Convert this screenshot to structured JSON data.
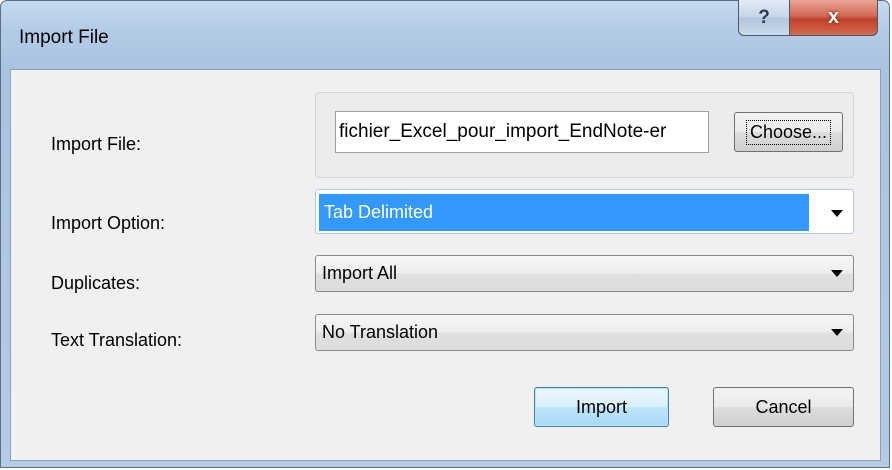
{
  "window": {
    "title": "Import File",
    "help_label": "?",
    "close_label": "x"
  },
  "form": {
    "import_file": {
      "label": "Import File:",
      "value": "fichier_Excel_pour_import_EndNote-er",
      "choose_label": "Choose..."
    },
    "import_option": {
      "label": "Import Option:",
      "selected": "Tab Delimited"
    },
    "duplicates": {
      "label": "Duplicates:",
      "selected": "Import All"
    },
    "text_translation": {
      "label": "Text Translation:",
      "selected": "No Translation"
    }
  },
  "buttons": {
    "import_label": "Import",
    "cancel_label": "Cancel"
  },
  "colors": {
    "selection_highlight": "#3399ff",
    "close_button": "#c0422a"
  }
}
